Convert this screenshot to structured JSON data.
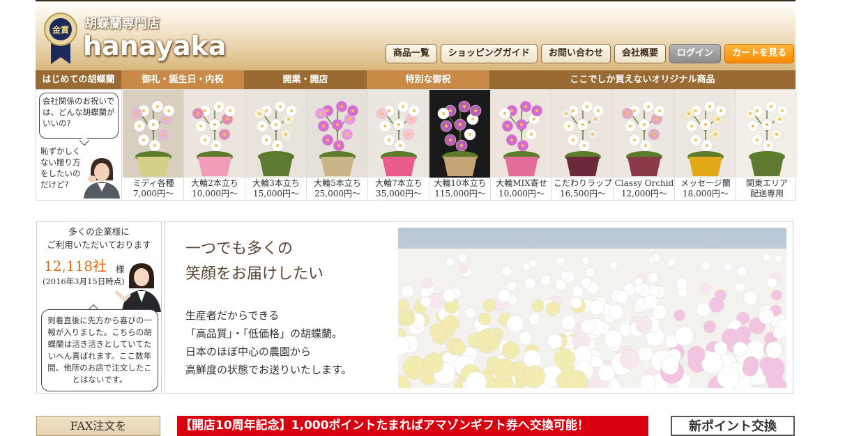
{
  "header": {
    "shop_sub": "胡蝶蘭専門店",
    "shop_name": "hanayaka",
    "medal_text": "金賞",
    "nav": [
      {
        "label": "商品一覧"
      },
      {
        "label": "ショッピングガイド"
      },
      {
        "label": "お問い合わせ"
      },
      {
        "label": "会社概要"
      },
      {
        "label": "ログイン"
      },
      {
        "label": "カートを見る"
      }
    ]
  },
  "categories": [
    {
      "label": "はじめての胡蝶蘭"
    },
    {
      "label": "御礼・誕生日・内祝"
    },
    {
      "label": "開業・開店"
    },
    {
      "label": "特別な御祝"
    },
    {
      "label": "ここでしか買えないオリジナル商品"
    }
  ],
  "intro": {
    "bubble": "会社関係のお祝いでは、どんな胡蝶蘭がいいの?",
    "question": "恥ずかしくない贈り方をしたいのだけど?"
  },
  "products": [
    {
      "name": "ミディ各種",
      "price": "7,000円〜"
    },
    {
      "name": "大輪2本立ち",
      "price": "10,000円〜"
    },
    {
      "name": "大輪3本立ち",
      "price": "15,000円〜"
    },
    {
      "name": "大輪5本立ち",
      "price": "25,000円〜"
    },
    {
      "name": "大輪7本立ち",
      "price": "35,000円〜"
    },
    {
      "name": "大輪10本立ち",
      "price": "115,000円〜"
    },
    {
      "name": "大輪MIX寄せ",
      "price": "10,000円〜"
    },
    {
      "name": "こだわりラップ",
      "price": "16,500円〜"
    },
    {
      "name": "Classy Orchid",
      "price": "12,000円〜"
    },
    {
      "name": "メッセージ蘭",
      "price": "18,000円〜"
    },
    {
      "name": "関東エリア",
      "price": "配送専用"
    }
  ],
  "corp": {
    "line1": "多くの企業様に",
    "line2": "ご利用いただいております",
    "count": "12,118社",
    "unit": "様",
    "date": "(2016年3月15日時点)",
    "testimonial": "到着直後に先方から喜びの一報が入りました。こちらの胡蝶蘭は活き活きとしていてたいへん喜ばれます。ここ数年間、他所のお店で注文したことはないです。"
  },
  "hero": {
    "heading1": "一つでも多くの",
    "heading2": "笑顔をお届けしたい",
    "p1": "生産者だからできる",
    "p2": "「高品質」・「低価格」の胡蝶蘭。",
    "p3": "日本のほぼ中心の農園から",
    "p4": "高鮮度の状態でお送りいたします。"
  },
  "bottom": {
    "fax": "FAX注文を",
    "campaign": "【開店10周年記念】1,000ポイントたまればアマゾンギフト券へ交換可能！",
    "point": "新ポイント交換"
  }
}
